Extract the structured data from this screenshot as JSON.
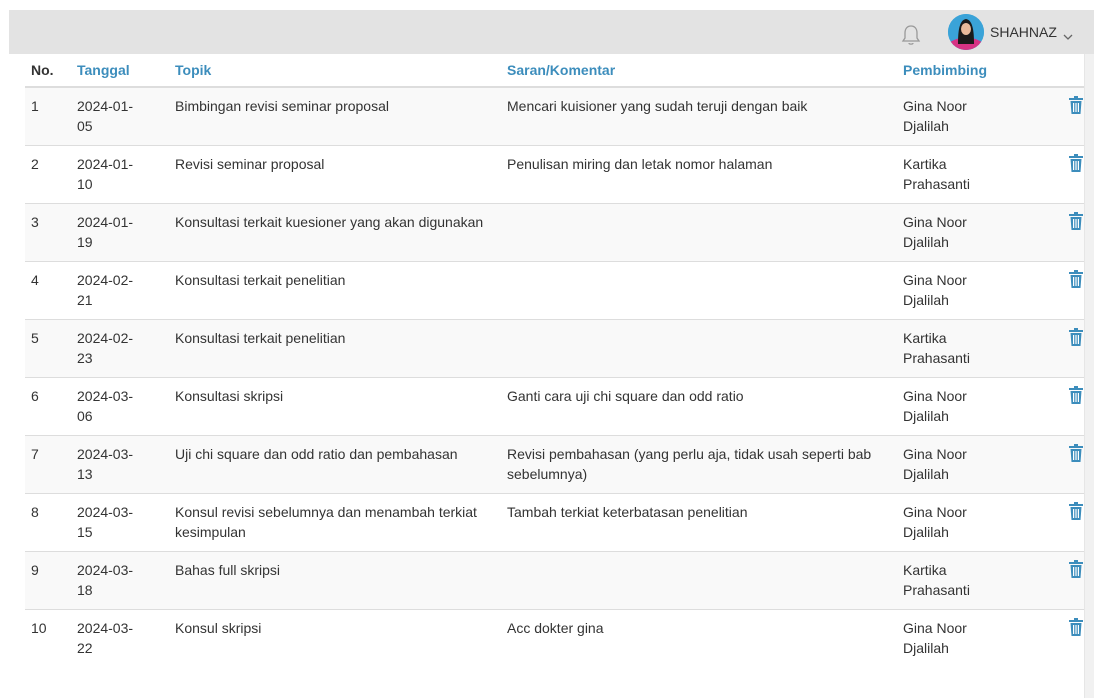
{
  "header": {
    "user_name": "SHAHNAZ"
  },
  "table": {
    "columns": [
      "No.",
      "Tanggal",
      "Topik",
      "Saran/Komentar",
      "Pembimbing"
    ],
    "rows": [
      {
        "no": "1",
        "tanggal_1": "2024-01-",
        "tanggal_2": "05",
        "topik": "Bimbingan revisi seminar proposal",
        "saran": "Mencari kuisioner yang sudah teruji dengan baik",
        "pembimbing_1": "Gina Noor",
        "pembimbing_2": "Djalilah"
      },
      {
        "no": "2",
        "tanggal_1": "2024-01-",
        "tanggal_2": "10",
        "topik": "Revisi seminar proposal",
        "saran": "Penulisan miring dan letak nomor halaman",
        "pembimbing_1": "Kartika",
        "pembimbing_2": "Prahasanti"
      },
      {
        "no": "3",
        "tanggal_1": "2024-01-",
        "tanggal_2": "19",
        "topik": "Konsultasi terkait kuesioner yang akan digunakan",
        "saran": "",
        "pembimbing_1": "Gina Noor",
        "pembimbing_2": "Djalilah"
      },
      {
        "no": "4",
        "tanggal_1": "2024-02-",
        "tanggal_2": "21",
        "topik": "Konsultasi terkait penelitian",
        "saran": "",
        "pembimbing_1": "Gina Noor",
        "pembimbing_2": "Djalilah"
      },
      {
        "no": "5",
        "tanggal_1": "2024-02-",
        "tanggal_2": "23",
        "topik": "Konsultasi terkait penelitian",
        "saran": "",
        "pembimbing_1": "Kartika",
        "pembimbing_2": "Prahasanti"
      },
      {
        "no": "6",
        "tanggal_1": "2024-03-",
        "tanggal_2": "06",
        "topik": "Konsultasi skripsi",
        "saran": "Ganti cara uji chi square dan odd ratio",
        "pembimbing_1": "Gina Noor",
        "pembimbing_2": "Djalilah"
      },
      {
        "no": "7",
        "tanggal_1": "2024-03-",
        "tanggal_2": "13",
        "topik": "Uji chi square dan odd ratio dan pembahasan",
        "saran": "Revisi pembahasan (yang perlu aja, tidak usah seperti bab sebelumnya)",
        "pembimbing_1": "Gina Noor",
        "pembimbing_2": "Djalilah"
      },
      {
        "no": "8",
        "tanggal_1": "2024-03-",
        "tanggal_2": "15",
        "topik": "Konsul revisi sebelumnya dan menambah terkiat kesimpulan",
        "saran": "Tambah terkiat keterbatasan penelitian",
        "pembimbing_1": "Gina Noor",
        "pembimbing_2": "Djalilah"
      },
      {
        "no": "9",
        "tanggal_1": "2024-03-",
        "tanggal_2": "18",
        "topik": "Bahas full skripsi",
        "saran": "",
        "pembimbing_1": "Kartika",
        "pembimbing_2": "Prahasanti"
      },
      {
        "no": "10",
        "tanggal_1": "2024-03-",
        "tanggal_2": "22",
        "topik": "Konsul skripsi",
        "saran": "Acc dokter gina",
        "pembimbing_1": "Gina Noor",
        "pembimbing_2": "Djalilah"
      }
    ]
  },
  "icons": {
    "bell": "bell-icon",
    "chevron": "chevron-down-icon",
    "delete": "trash-icon"
  },
  "colors": {
    "topbar": "#e3e3e3",
    "header_link": "#3c8dbc",
    "trash": "#3c8dbc",
    "row_stripe": "#f9f9f9"
  }
}
